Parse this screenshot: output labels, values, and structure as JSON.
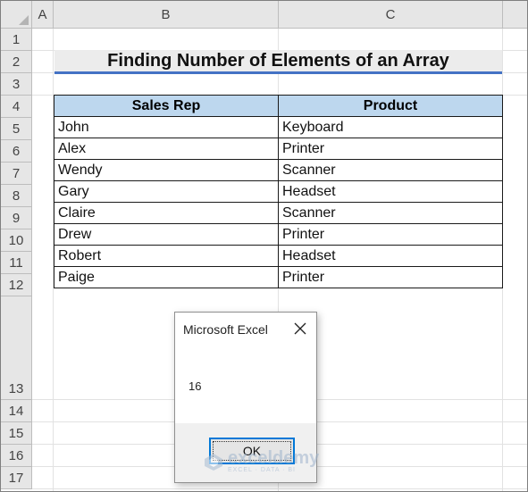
{
  "columns": [
    "A",
    "B",
    "C"
  ],
  "rows": [
    "1",
    "2",
    "3",
    "4",
    "5",
    "6",
    "7",
    "8",
    "9",
    "10",
    "11",
    "12",
    "13",
    "14",
    "15",
    "16",
    "17"
  ],
  "title": "Finding Number of Elements of an Array",
  "table": {
    "headers": [
      "Sales Rep",
      "Product"
    ],
    "rows": [
      [
        "John",
        "Keyboard"
      ],
      [
        "Alex",
        "Printer"
      ],
      [
        "Wendy",
        "Scanner"
      ],
      [
        "Gary",
        "Headset"
      ],
      [
        "Claire",
        "Scanner"
      ],
      [
        "Drew",
        "Printer"
      ],
      [
        "Robert",
        "Headset"
      ],
      [
        "Paige",
        "Printer"
      ]
    ]
  },
  "dialog": {
    "title": "Microsoft Excel",
    "message": "16",
    "ok_label": "OK",
    "close_icon": "close-icon"
  },
  "watermark": {
    "name": "exceldemy",
    "tagline": "EXCEL · DATA · BI"
  },
  "colors": {
    "header_bg": "#e6e6e6",
    "table_header_bg": "#bdd7ee",
    "title_underline": "#4472c4",
    "dialog_button_border": "#0078d7"
  }
}
